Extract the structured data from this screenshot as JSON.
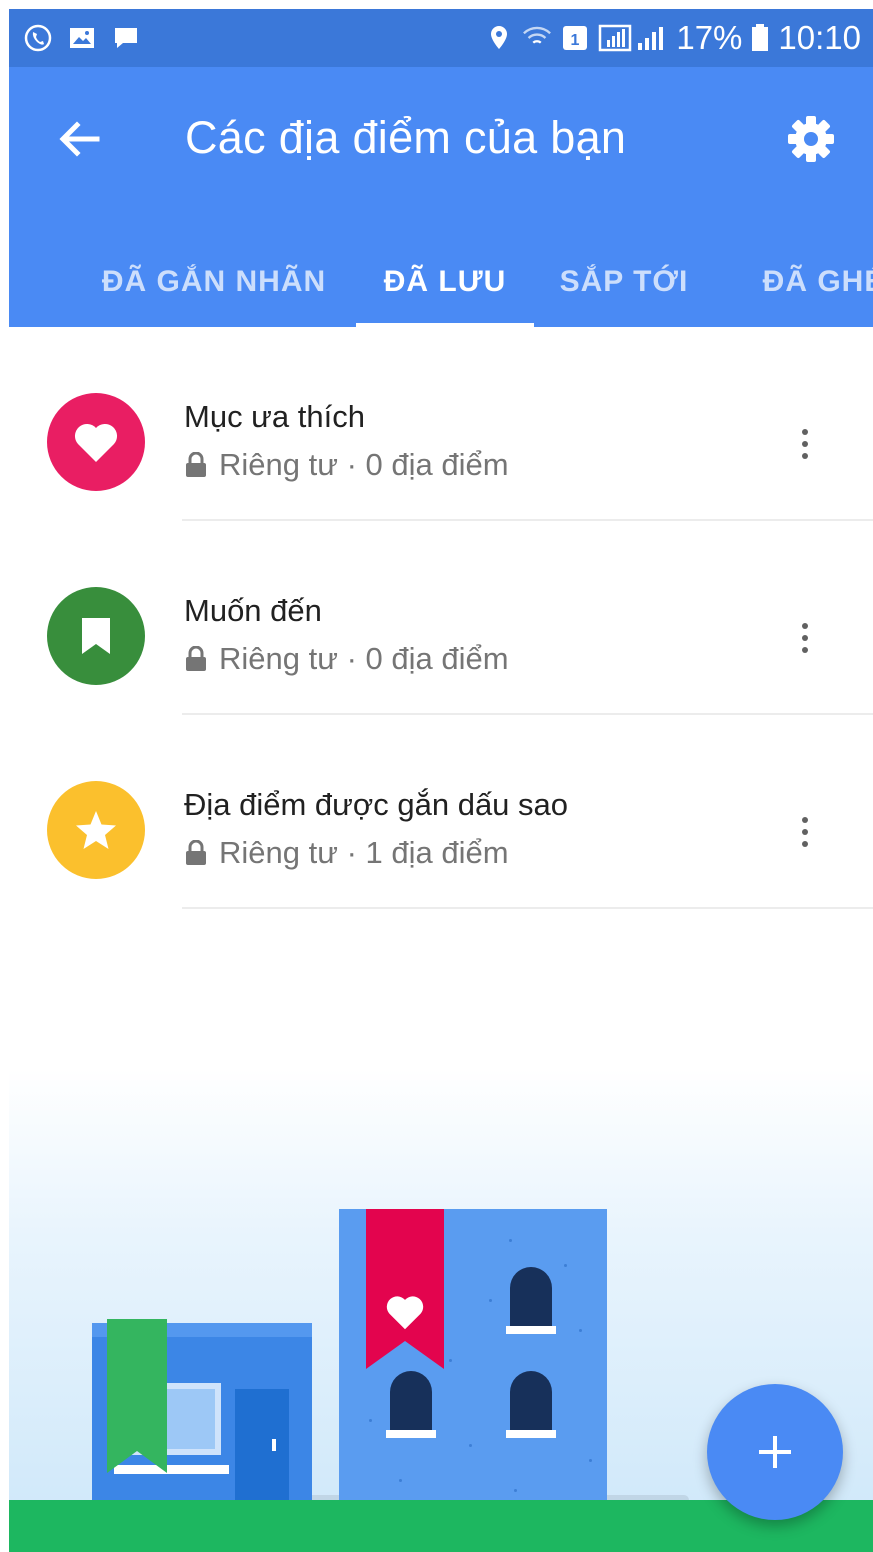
{
  "status_bar": {
    "battery": "17%",
    "time": "10:10",
    "left_icons": [
      "viber-icon",
      "image-icon",
      "message-icon"
    ],
    "right_icons": [
      "location-icon",
      "wifi-icon",
      "sim-icon",
      "signal-icon",
      "battery-icon"
    ]
  },
  "app_bar": {
    "title": "Các địa điểm của bạn",
    "back_icon": "arrow-back-icon",
    "settings_icon": "gear-icon",
    "color": "#4a8af4"
  },
  "tabs": [
    {
      "label": "ĐÃ GẮN NHÃN",
      "active": false
    },
    {
      "label": "ĐÃ LƯU",
      "active": true
    },
    {
      "label": "SẮP TỚI",
      "active": false
    },
    {
      "label": "ĐÃ GHÉ",
      "active": false
    }
  ],
  "lists": [
    {
      "name": "Mục ưa thích",
      "privacy": "Riêng tư",
      "count": "0 địa điểm",
      "meta": "Riêng tư · 0 địa điểm",
      "icon": "heart-icon",
      "color": "#e91e63"
    },
    {
      "name": "Muốn đến",
      "privacy": "Riêng tư",
      "count": "0 địa điểm",
      "meta": "Riêng tư · 0 địa điểm",
      "icon": "bookmark-icon",
      "color": "#388e3c"
    },
    {
      "name": "Địa điểm được gắn dấu sao",
      "privacy": "Riêng tư",
      "count": "1 địa điểm",
      "meta": "Riêng tư · 1 địa điểm",
      "icon": "star-icon",
      "color": "#fbc02d"
    }
  ],
  "fab": {
    "icon": "plus-icon"
  }
}
